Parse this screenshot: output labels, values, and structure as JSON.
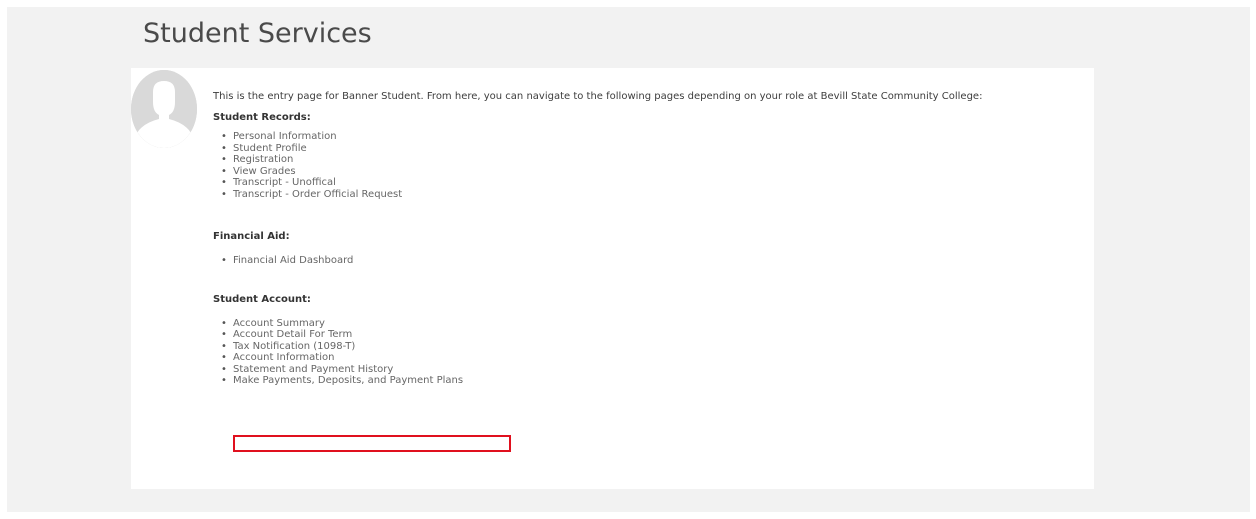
{
  "page": {
    "title": "Student Services"
  },
  "intro": "This is the entry page for Banner Student. From here, you can navigate to the following pages depending on your role at Bevill State Community College:",
  "sections": [
    {
      "heading": "Student Records:",
      "items": [
        "Personal Information",
        "Student Profile",
        "Registration",
        "View Grades",
        "Transcript - Unoffical",
        "Transcript - Order Official Request"
      ]
    },
    {
      "heading": "Financial Aid:",
      "items": [
        "Financial Aid Dashboard"
      ]
    },
    {
      "heading": "Student Account:",
      "items": [
        "Account Summary",
        "Account Detail For Term",
        "Tax Notification (1098-T)",
        "Account Information",
        "Statement and Payment History",
        "Make Payments, Deposits, and Payment Plans"
      ]
    }
  ],
  "icons": {
    "bullet": "•",
    "avatar": "avatar-placeholder-icon"
  },
  "colors": {
    "highlight": "#e0101e",
    "background": "#f2f2f2",
    "panel": "#ffffff",
    "avatar": "#d9d9d9"
  }
}
